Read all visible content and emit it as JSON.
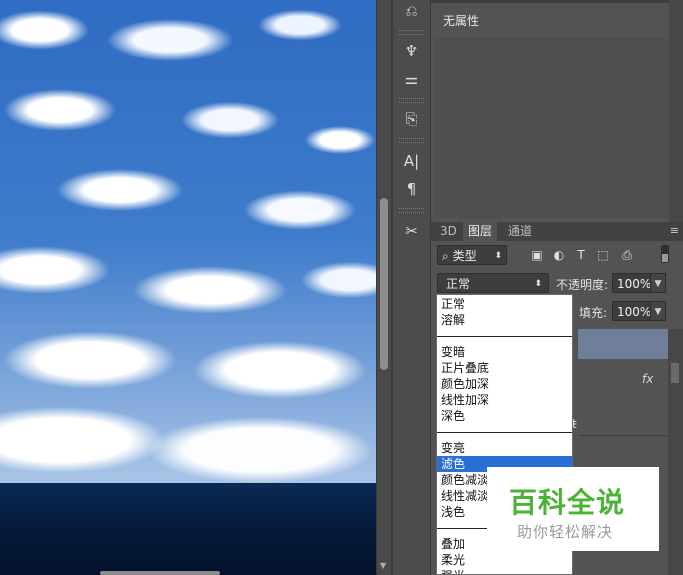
{
  "properties_panel": {
    "title": "无属性"
  },
  "layers_panel": {
    "tabs": [
      {
        "label": "3D",
        "active": false
      },
      {
        "label": "图层",
        "active": true
      },
      {
        "label": "通道",
        "active": false
      }
    ],
    "filter_kind": "类型",
    "blend_mode": "正常",
    "opacity_label": "不透明度:",
    "opacity_value": "100%",
    "fill_label": "填充:",
    "fill_value": "100%",
    "fx_label": "fx",
    "partial_text": "ŧ"
  },
  "blend_dropdown": {
    "groups": [
      [
        "正常",
        "溶解"
      ],
      [
        "变暗",
        "正片叠底",
        "颜色加深",
        "线性加深",
        "深色"
      ],
      [
        "变亮",
        "滤色",
        "颜色减淡",
        "线性减淡",
        "浅色"
      ],
      [
        "叠加",
        "柔光",
        "强光"
      ]
    ],
    "selected": "滤色"
  },
  "watermark": {
    "main": "百科全说",
    "sub": "助你轻松解决",
    "color": "#4bb336"
  },
  "icons": {
    "tools": [
      "history-brush-icon",
      "brush-settings-icon",
      "adjustments-icon",
      "clone-source-icon",
      "character-icon",
      "paragraph-icon",
      "tool-presets-icon"
    ],
    "filters": [
      "image-filter-icon",
      "adjustment-filter-icon",
      "type-filter-icon",
      "shape-filter-icon",
      "smart-object-filter-icon"
    ]
  }
}
